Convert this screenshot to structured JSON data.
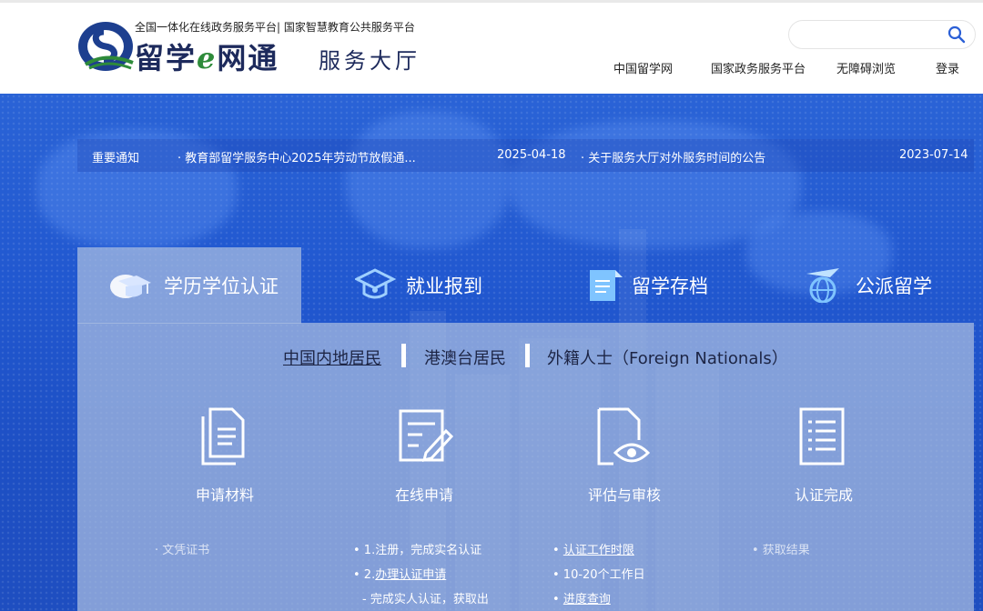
{
  "header": {
    "slogan": "全国一体化在线政务服务平台| 国家智慧教育公共服务平台",
    "brand_main_1": "留学",
    "brand_main_e": "e",
    "brand_main_2": "网通",
    "brand_sub": "服务大厅",
    "search_placeholder": "",
    "nav": [
      "中国留学网",
      "国家政务服务平台",
      "无障碍浏览",
      "登录"
    ]
  },
  "notices": {
    "label": "重要通知",
    "items": [
      {
        "title": "· 教育部留学服务中心2025年劳动节放假通...",
        "date": "2025-04-18"
      },
      {
        "title": "· 关于服务大厅对外服务时间的公告",
        "date": "2023-07-14"
      }
    ]
  },
  "tabs": [
    "学历学位认证",
    "就业报到",
    "留学存档",
    "公派留学"
  ],
  "subtabs": [
    "中国内地居民",
    "港澳台居民",
    "外籍人士（Foreign Nationals）"
  ],
  "steps": [
    "申请材料",
    "在线申请",
    "评估与审核",
    "认证完成"
  ],
  "lists": {
    "col1": [
      "· 文凭证书"
    ],
    "col2": [
      "• 1.注册，完成实名认证",
      "• 2.",
      "办理认证申请",
      "- 完成实人认证，获取出"
    ],
    "col3": [
      "• ",
      "认证工作时限",
      "• 10-20个工作日",
      "• ",
      "进度查询"
    ],
    "col4": [
      "• 获取结果"
    ]
  },
  "colors": {
    "brand": "#1d2a5c",
    "hero": "#1e4fc9",
    "panel": "#aabee1",
    "accent_e": "#2e8b3a"
  }
}
